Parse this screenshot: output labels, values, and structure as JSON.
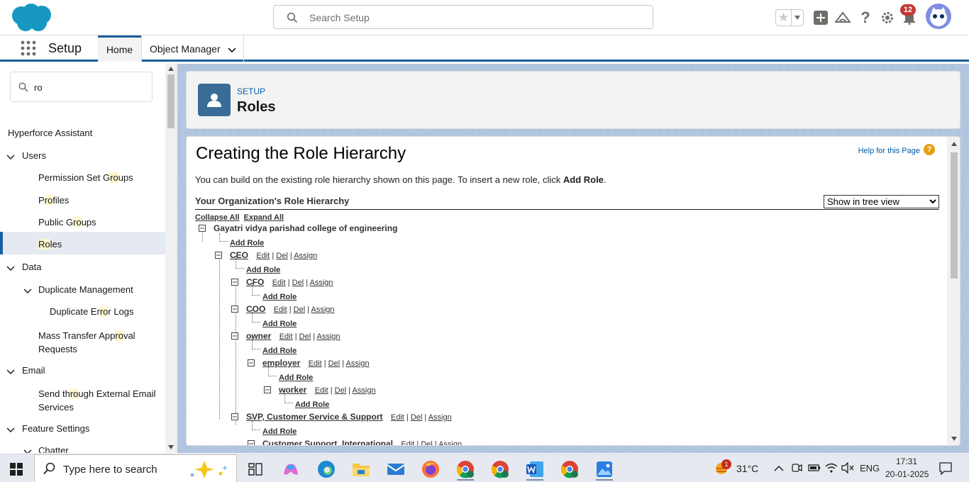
{
  "header": {
    "search_placeholder": "Search Setup",
    "notification_count": "12",
    "icons": [
      "star-icon",
      "add-icon",
      "trailhead-icon",
      "help-icon",
      "gear-icon",
      "bell-icon",
      "avatar"
    ]
  },
  "context_bar": {
    "app_name": "Setup",
    "tabs": [
      {
        "label": "Home",
        "active": true
      },
      {
        "label": "Object Manager",
        "active": false
      }
    ]
  },
  "sidebar": {
    "quickfind_value": "ro",
    "items": [
      {
        "label": "Hyperforce Assistant"
      },
      {
        "label": "Users"
      },
      {
        "label": "Permission Set Groups"
      },
      {
        "label": "Profiles"
      },
      {
        "label": "Public Groups"
      },
      {
        "label": "Roles"
      },
      {
        "label": "Data"
      },
      {
        "label": "Duplicate Management"
      },
      {
        "label": "Duplicate Error Logs"
      },
      {
        "label": "Mass Transfer Approval Requests"
      },
      {
        "label": "Email"
      },
      {
        "label": "Send through External Email Services"
      },
      {
        "label": "Feature Settings"
      },
      {
        "label": "Chatter"
      }
    ]
  },
  "page_header": {
    "eyebrow": "SETUP",
    "title": "Roles"
  },
  "content": {
    "heading": "Creating the Role Hierarchy",
    "help_link": "Help for this Page",
    "intro_text": "You can build on the existing role hierarchy shown on this page. To insert a new role, click ",
    "intro_bold": "Add Role",
    "intro_end": ".",
    "org_heading": "Your Organization's Role Hierarchy",
    "view_select": "Show in tree view",
    "collapse_all": "Collapse All",
    "expand_all": "Expand All",
    "root": "Gayatri vidya parishad college of engineering",
    "add_role": "Add Role",
    "edit": "Edit",
    "del": "Del",
    "assign": "Assign",
    "sep": "|",
    "roles": [
      "CEO",
      "CFO",
      "COO",
      "owner",
      "employer",
      "worker",
      "SVP, Customer Service & Support",
      "Customer Support, International"
    ]
  },
  "taskbar": {
    "search_placeholder": "Type here to search",
    "weather": "31°C",
    "weather_badge": "1",
    "language": "ENG",
    "time": "17:31",
    "date": "20-01-2025"
  }
}
